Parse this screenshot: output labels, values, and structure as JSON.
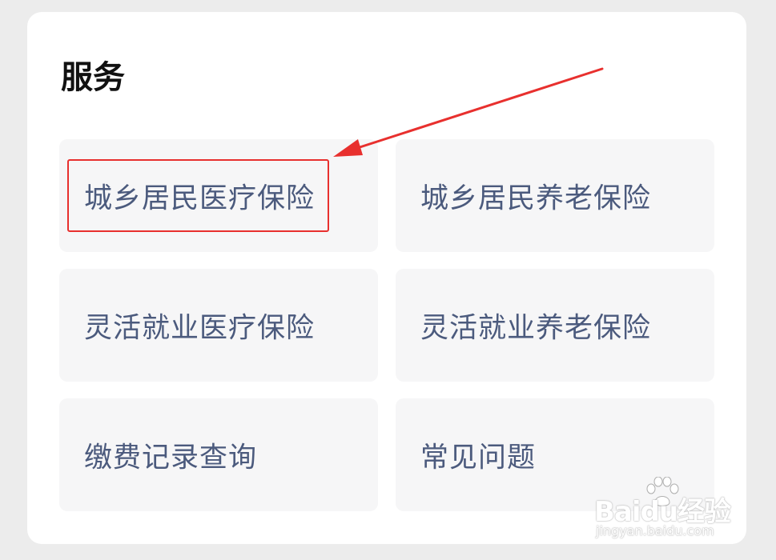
{
  "section": {
    "title": "服务"
  },
  "services": [
    {
      "label": "城乡居民医疗保险"
    },
    {
      "label": "城乡居民养老保险"
    },
    {
      "label": "灵活就业医疗保险"
    },
    {
      "label": "灵活就业养老保险"
    },
    {
      "label": "缴费记录查询"
    },
    {
      "label": "常见问题"
    }
  ],
  "annotation": {
    "color": "#e8302e"
  },
  "watermark": {
    "brand": "Baidu经验",
    "url": "jingyan.baidu.com"
  },
  "colors": {
    "tile_bg": "#f6f6f7",
    "label": "#4b5a7d",
    "page_bg": "#ececec"
  }
}
